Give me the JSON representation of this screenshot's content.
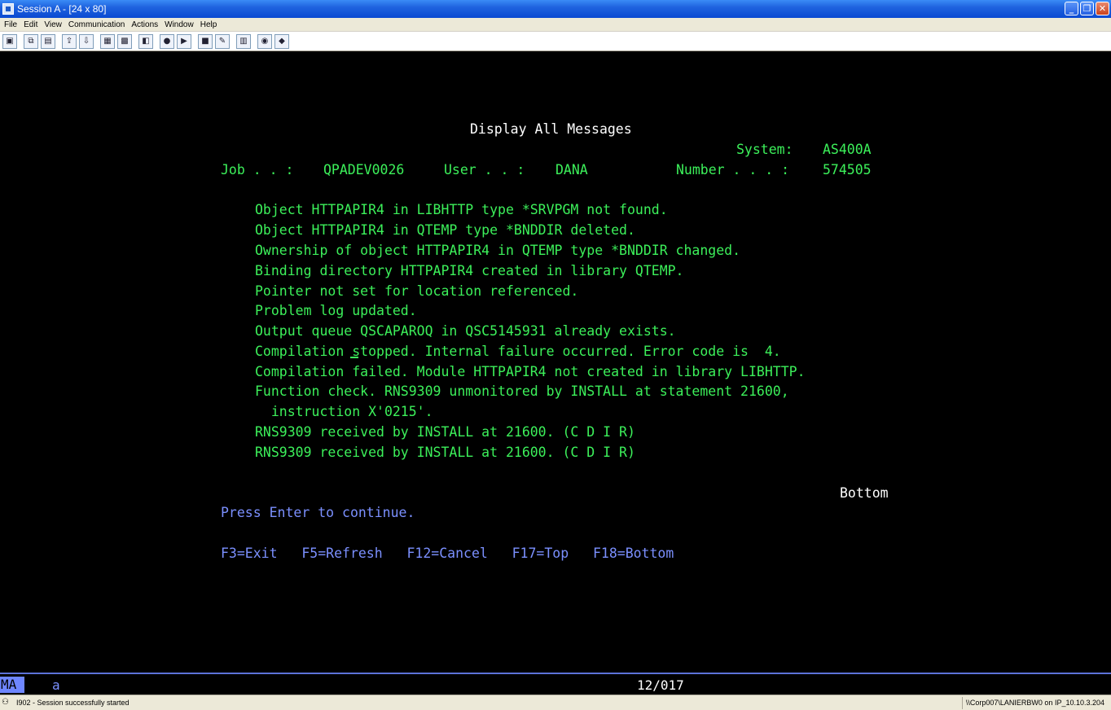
{
  "window": {
    "title": "Session A - [24 x 80]",
    "minimize": "_",
    "maximize": "❐",
    "close": "✕"
  },
  "menu": [
    "File",
    "Edit",
    "View",
    "Communication",
    "Actions",
    "Window",
    "Help"
  ],
  "toolbar_icons": [
    "print-screen-icon",
    "copy-icon",
    "paste-icon",
    "send-icon",
    "receive-icon",
    "display-icon",
    "keypad-icon",
    "macro-icon",
    "record-icon",
    "play-icon",
    "stop-icon",
    "edit-icon",
    "clipboard-icon",
    "globe-icon",
    "support-icon"
  ],
  "screen": {
    "title": "Display All Messages",
    "system_label": "System:",
    "system_value": "AS400A",
    "job_label": "Job . . :",
    "job_value": "QPADEV0026",
    "user_label": "User . . :",
    "user_value": "DANA",
    "number_label": "Number . . . :",
    "number_value": "574505",
    "messages": [
      "Object HTTPAPIR4 in LIBHTTP type *SRVPGM not found.",
      "Object HTTPAPIR4 in QTEMP type *BNDDIR deleted.",
      "Ownership of object HTTPAPIR4 in QTEMP type *BNDDIR changed.",
      "Binding directory HTTPAPIR4 created in library QTEMP.",
      "Pointer not set for location referenced.",
      "Problem log updated.",
      "Output queue QSCAPAROQ in QSC5145931 already exists.",
      "Compilation stopped. Internal failure occurred. Error code is  4.",
      "Compilation failed. Module HTTPAPIR4 not created in library LIBHTTP.",
      "Function check. RNS9309 unmonitored by INSTALL at statement 21600,",
      "  instruction X'0215'.",
      "RNS9309 received by INSTALL at 21600. (C D I R)",
      "RNS9309 received by INSTALL at 21600. (C D I R)"
    ],
    "bottom": "Bottom",
    "prompt": "Press Enter to continue.",
    "function_keys": "F3=Exit   F5=Refresh   F12=Cancel   F17=Top   F18=Bottom"
  },
  "oia": {
    "mode": "MA",
    "indicator": "a",
    "cursor_position": "12/017"
  },
  "status": {
    "message": "I902 - Session successfully started",
    "host": "\\\\Corp007\\LANIERBW0 on IP_10.10.3.204"
  }
}
